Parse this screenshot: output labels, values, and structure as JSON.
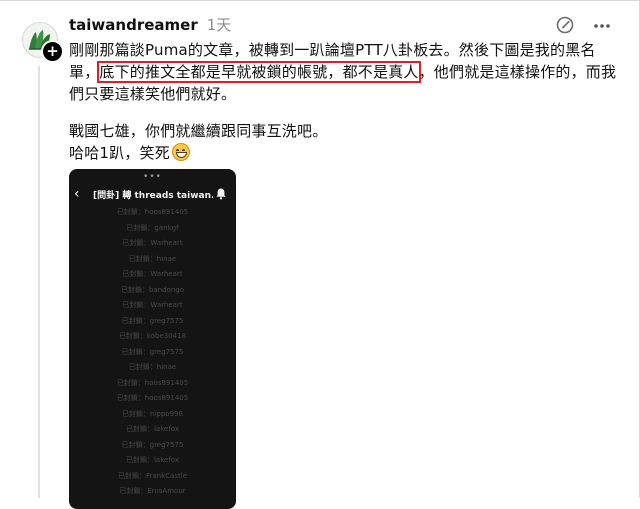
{
  "post": {
    "username": "taiwandreamer",
    "time": "1天",
    "line1": "剛剛那篇談Puma的文章，被轉到一趴論壇PTT八卦板去。然後下圖是我的黑名",
    "line2_prefix": "單，",
    "line2_highlight": "底下的推文全都是早就被鎖的帳號，都不是真人",
    "line2_suffix": "，他們就是這樣操作的，而我",
    "line3": "們只要這樣笑他們就好。",
    "line4": "戰國七雄，你們就繼續跟同事互洗吧。",
    "line5": "哈哈1趴，笑死",
    "emoji": "grinning-face"
  },
  "phone": {
    "dots": "•••",
    "title": "[問卦] 轉 threads taiwan...",
    "rows": [
      "已封鎖：hoos891405",
      "已封鎖：gankgf",
      "已封鎖：Warheart",
      "已封鎖：hinae",
      "已封鎖：Warheart",
      "已封鎖：bandongo",
      "已封鎖：Warheart",
      "已封鎖：greg7575",
      "已封鎖：kobe30418",
      "已封鎖：greg7575",
      "已封鎖：hinae",
      "已封鎖：hoos891405",
      "已封鎖：hoos891405",
      "已封鎖：nippo998",
      "已封鎖：lakefox",
      "已封鎖：greg7575",
      "已封鎖：lakefox",
      "已封鎖：FrankCastle",
      "已封鎖：ErosAmour"
    ]
  },
  "colors": {
    "highlight_box": "#d9231f",
    "phone_bg": "#141414",
    "muted_text": "#8e8e8e"
  },
  "icons": [
    "avatar",
    "follow-plus-icon",
    "edit-icon",
    "more-icon",
    "back-chevron-icon",
    "bell-icon"
  ]
}
